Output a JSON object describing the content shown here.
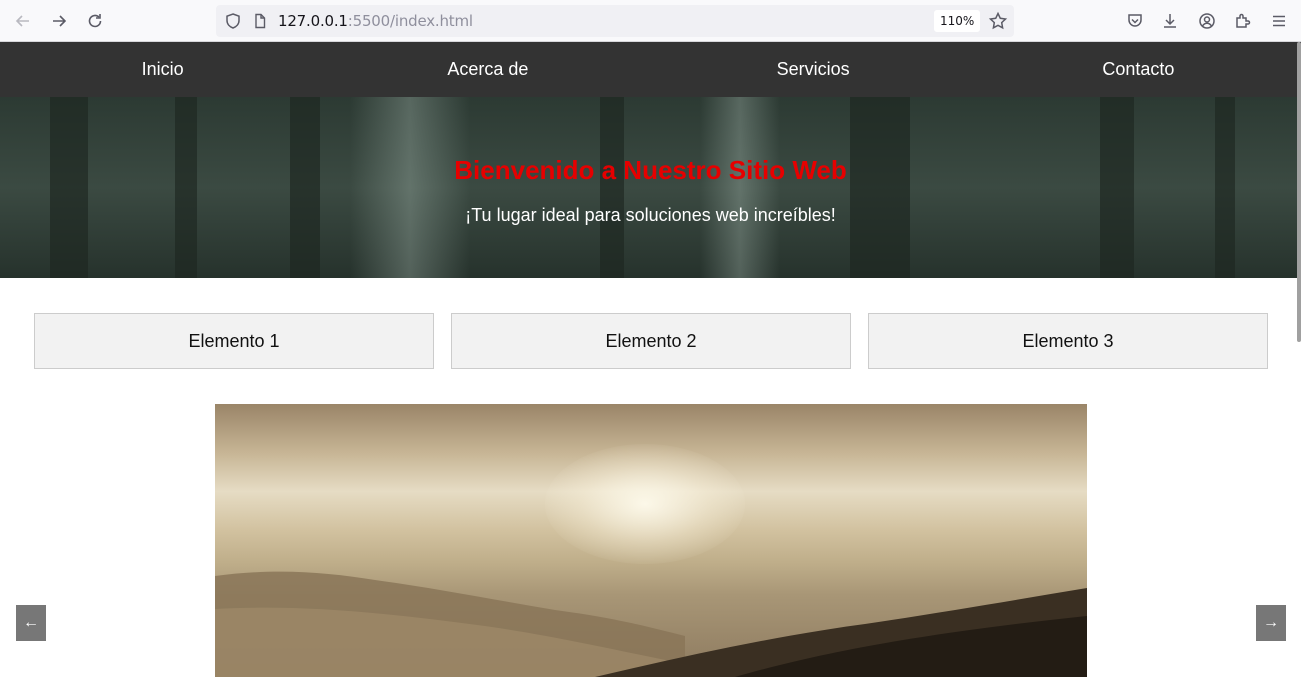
{
  "browser": {
    "url_host": "127.0.0.1",
    "url_rest": ":5500/index.html",
    "zoom": "110%"
  },
  "nav": {
    "items": [
      "Inicio",
      "Acerca de",
      "Servicios",
      "Contacto"
    ]
  },
  "hero": {
    "title": "Bienvenido a Nuestro Sitio Web",
    "subtitle": "¡Tu lugar ideal para soluciones web increíbles!"
  },
  "items": [
    "Elemento 1",
    "Elemento 2",
    "Elemento 3"
  ],
  "carousel": {
    "prev_label": "←",
    "next_label": "→"
  },
  "colors": {
    "nav_bg": "#333333",
    "hero_title": "#e60000",
    "item_bg": "#f2f2f2",
    "carousel_button": "#777777"
  }
}
